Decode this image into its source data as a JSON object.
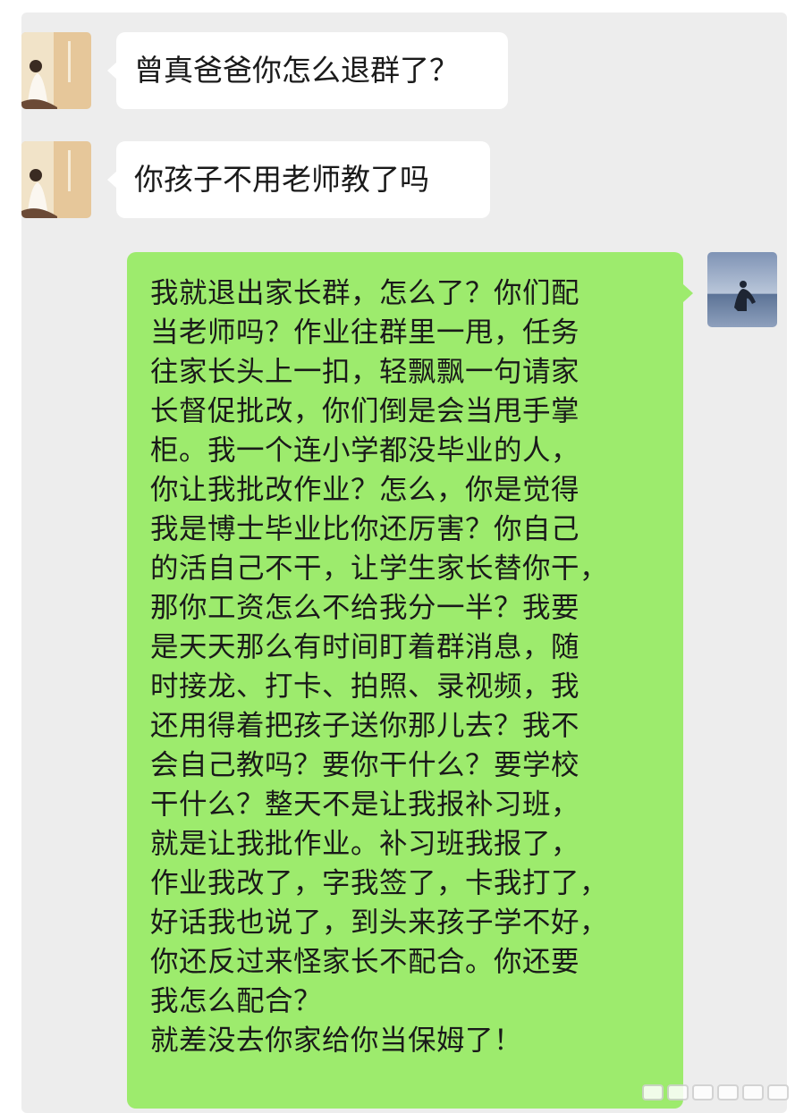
{
  "messages": [
    {
      "direction": "incoming",
      "text": "曾真爸爸你怎么退群了？"
    },
    {
      "direction": "incoming",
      "text": "你孩子不用老师教了吗"
    },
    {
      "direction": "outgoing",
      "lines": [
        "我就退出家长群，怎么了？你们配",
        "当老师吗？作业往群里一甩，任务",
        "往家长头上一扣，轻飘飘一句请家",
        "长督促批改，你们倒是会当甩手掌",
        "柜。我一个连小学都没毕业的人，",
        "你让我批改作业？怎么，你是觉得",
        "我是博士毕业比你还厉害？你自己",
        "的活自己不干，让学生家长替你干，",
        "那你工资怎么不给我分一半？我要",
        "是天天那么有时间盯着群消息，随",
        "时接龙、打卡、拍照、录视频，我",
        "还用得着把孩子送你那儿去？我不",
        "会自己教吗？要你干什么？要学校",
        "干什么？整天不是让我报补习班，",
        "就是让我批作业。补习班我报了，",
        "作业我改了，字我签了，卡我打了，",
        "好话我也说了，到头来孩子学不好，",
        "你还反过来怪家长不配合。你还要",
        "我怎么配合？",
        "就差没去你家给你当保姆了！"
      ]
    }
  ],
  "avatars": {
    "incoming": "avatar-illustrated-girl-icon",
    "outgoing": "avatar-person-by-sea-icon"
  },
  "colors": {
    "panel": "#ededed",
    "incoming_bubble": "#ffffff",
    "outgoing_bubble": "#9deb6d",
    "text": "#1a1a1a"
  }
}
